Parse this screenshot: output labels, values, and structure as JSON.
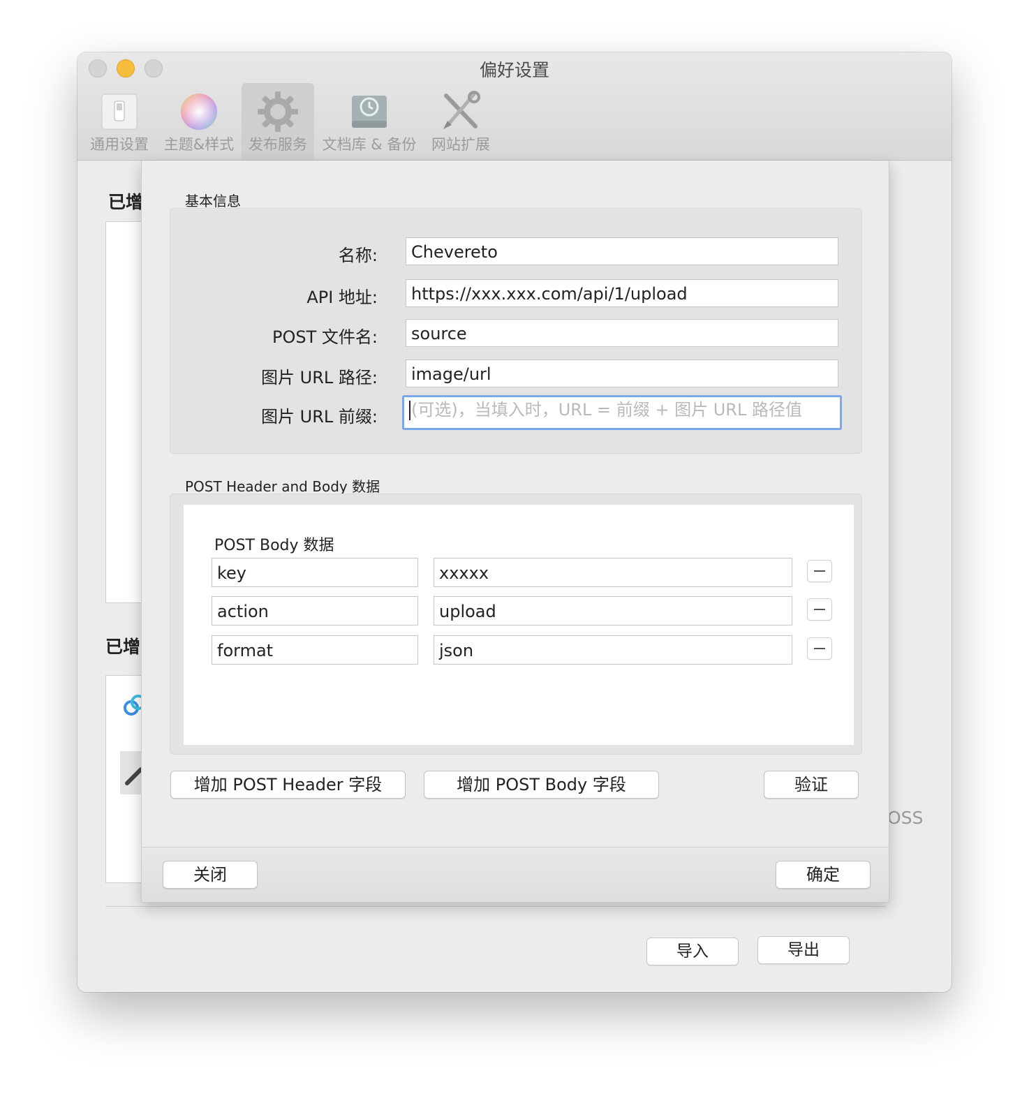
{
  "window": {
    "title": "偏好设置"
  },
  "toolbar": {
    "tabs": [
      {
        "label": "通用设置",
        "icon": "switch-icon"
      },
      {
        "label": "主题&样式",
        "icon": "color-wheel-icon"
      },
      {
        "label": "发布服务",
        "icon": "gear-icon",
        "active": true
      },
      {
        "label": "文档库 & 备份",
        "icon": "time-machine-drive-icon"
      },
      {
        "label": "网站扩展",
        "icon": "tools-icon"
      }
    ]
  },
  "background": {
    "label1": "已增",
    "label2": "已增",
    "oss_text": "OSS",
    "import_label": "导入",
    "export_label": "导出"
  },
  "sheet": {
    "basic": {
      "title": "基本信息",
      "fields": [
        {
          "label": "名称:",
          "value": "Chevereto"
        },
        {
          "label": "API 地址:",
          "value": "https://xxx.xxx.com/api/1/upload"
        },
        {
          "label": "POST 文件名:",
          "value": "source"
        },
        {
          "label": "图片 URL 路径:",
          "value": "image/url"
        },
        {
          "label": "图片 URL 前缀:",
          "placeholder": "(可选)，当填入时，URL = 前缀 + 图片 URL 路径值"
        }
      ]
    },
    "post": {
      "title": "POST Header and Body 数据",
      "body_title": "POST Body 数据",
      "rows": [
        {
          "key": "key",
          "value": "xxxxx"
        },
        {
          "key": "action",
          "value": "upload"
        },
        {
          "key": "format",
          "value": "json"
        }
      ]
    },
    "buttons": {
      "add_header": "增加 POST Header 字段",
      "add_body": "增加 POST Body 字段",
      "verify": "验证",
      "close": "关闭",
      "ok": "确定"
    }
  }
}
